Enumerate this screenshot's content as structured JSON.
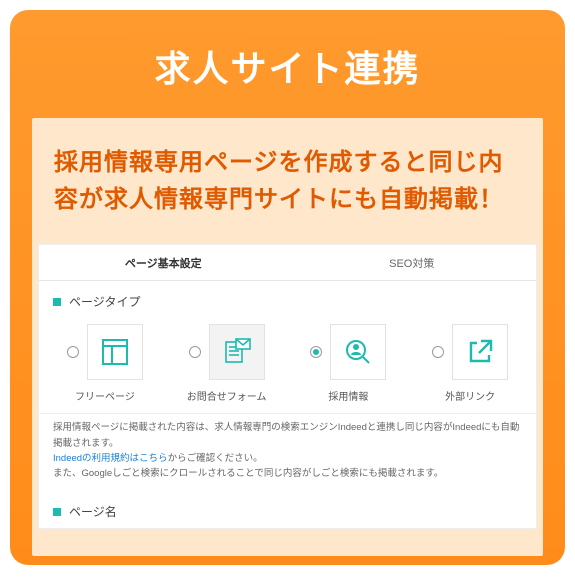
{
  "card": {
    "title": "求人サイト連携",
    "lead": "採用情報専用ページを作成すると同じ内容が求人情報専門サイトにも自動掲載！"
  },
  "panel": {
    "tabs": {
      "basic": "ページ基本設定",
      "seo": "SEO対策"
    },
    "section_page_type": "ページタイプ",
    "types": {
      "free": "フリーページ",
      "contact": "お問合せフォーム",
      "recruit": "採用情報",
      "external": "外部リンク"
    },
    "note_line1": "採用情報ページに掲載された内容は、求人情報専門の検索エンジンIndeedと連携し同じ内容がIndeedにも自動掲載されます。",
    "note_link": "Indeedの利用規約はこちら",
    "note_link_suffix": "からご確認ください。",
    "note_line2": "また、Googleしごと検索にクロールされることで同じ内容がしごと検索にも掲載されます。",
    "section_page_name": "ページ名"
  }
}
